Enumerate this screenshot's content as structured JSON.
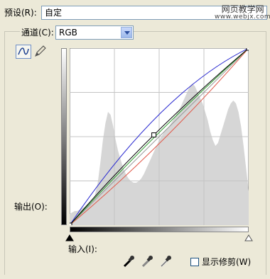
{
  "preset": {
    "label": "预设(R):",
    "value": "自定"
  },
  "watermark": {
    "line1": "网页教学网",
    "line2": "www.webjx.com"
  },
  "channel": {
    "label": "通道(C):",
    "value": "RGB"
  },
  "output_label": "输出(O):",
  "input_label": "输入(I):",
  "show_clipping": {
    "label": "显示修剪(W)",
    "checked": false
  },
  "icons": {
    "curve_tool": "curve-icon",
    "pencil_tool": "pencil-icon",
    "eyedroppers": [
      "black-eyedropper-icon",
      "gray-eyedropper-icon",
      "white-eyedropper-icon"
    ]
  },
  "colors": {
    "rgb_curve": "#000000",
    "red_curve": "#e05a4a",
    "green_curve": "#2a9a2a",
    "blue_curve": "#2a2ad0",
    "histogram": "#d6d6d6",
    "baseline": "#9a9a9a"
  },
  "chart_data": {
    "type": "curves",
    "curves": [
      {
        "name": "RGB",
        "points": [
          [
            0,
            0
          ],
          [
            120,
            130
          ],
          [
            255,
            255
          ]
        ]
      },
      {
        "name": "Red",
        "points": [
          [
            0,
            0
          ],
          [
            128,
            118
          ],
          [
            255,
            255
          ]
        ]
      },
      {
        "name": "Green",
        "points": [
          [
            0,
            0
          ],
          [
            128,
            134
          ],
          [
            255,
            255
          ]
        ]
      },
      {
        "name": "Blue",
        "points": [
          [
            0,
            0
          ],
          [
            128,
            160
          ],
          [
            255,
            255
          ]
        ]
      }
    ],
    "histogram": [
      8,
      9,
      10,
      10,
      11,
      12,
      13,
      15,
      16,
      18,
      22,
      30,
      44,
      60,
      72,
      80,
      78,
      70,
      60,
      52,
      46,
      40,
      36,
      33,
      31,
      30,
      30,
      31,
      33,
      36,
      40,
      44,
      48,
      52,
      56,
      60,
      63,
      66,
      68,
      70,
      73,
      76,
      79,
      82,
      86,
      90,
      94,
      98,
      100,
      98,
      94,
      90,
      86,
      80,
      74,
      66,
      60,
      56,
      58,
      64,
      70,
      76,
      82,
      86,
      88,
      86,
      80,
      70,
      56,
      40,
      24
    ],
    "xlim": [
      0,
      255
    ],
    "ylim": [
      0,
      255
    ]
  }
}
